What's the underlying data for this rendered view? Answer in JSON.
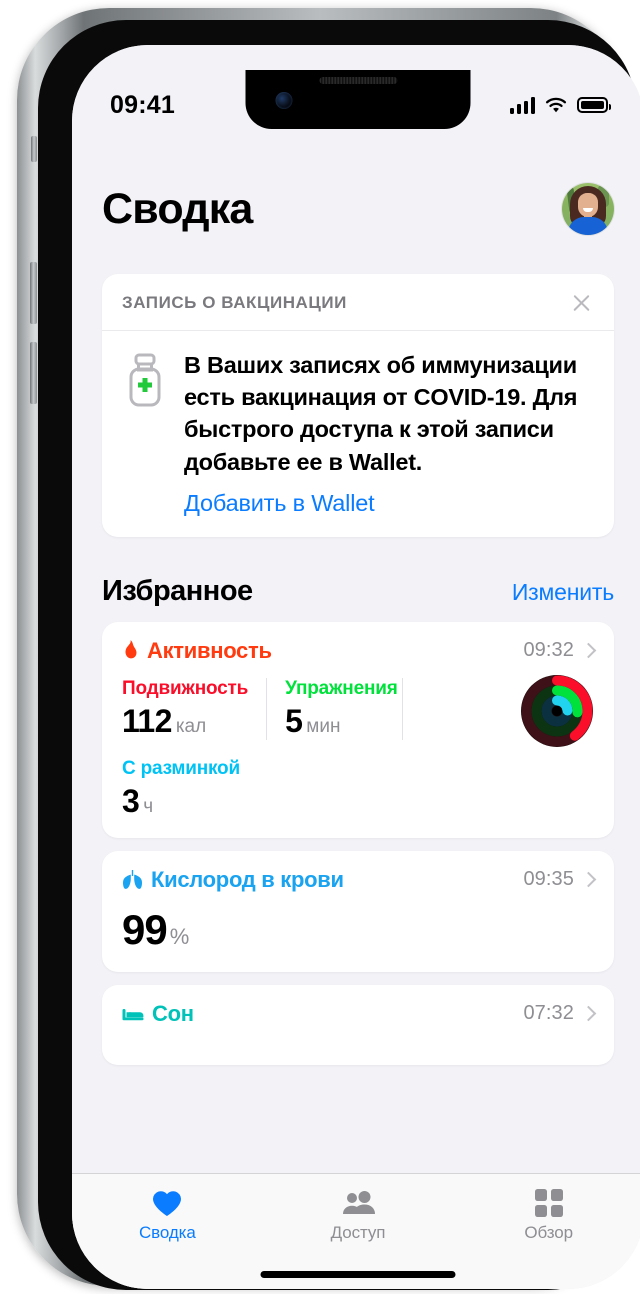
{
  "status_bar": {
    "time": "09:41",
    "icons": [
      "cellular-signal-icon",
      "wifi-icon",
      "battery-icon"
    ]
  },
  "header": {
    "title": "Сводка",
    "avatar_alt": "profile-avatar"
  },
  "vaccination_card": {
    "header_title": "ЗАПИСЬ О ВАКЦИНАЦИИ",
    "close_icon": "close-icon",
    "vial_icon": "vaccine-vial-icon",
    "message": "В Ваших записях об иммунизации есть вакцинация от COVID-19. Для быстрого доступа к этой записи добавьте ее в Wallet.",
    "action_label": "Добавить в Wallet"
  },
  "favorites": {
    "title": "Избранное",
    "edit_label": "Изменить",
    "cards": [
      {
        "name": "Активность",
        "icon": "flame-icon",
        "color": "#FF3B0F",
        "time": "09:32",
        "metrics": [
          {
            "label": "Подвижность",
            "value": "112",
            "unit": "кал",
            "color": "#FA0E2A"
          },
          {
            "label": "Упражнения",
            "value": "5",
            "unit": "мин",
            "color": "#00E23B"
          },
          {
            "label": "С разминкой",
            "value": "3",
            "unit": "ч",
            "color": "#00C3F5"
          }
        ],
        "rings": {
          "move_pct": 40,
          "exercise_pct": 26,
          "stand_pct": 24,
          "move_color": "#FA0E2A",
          "exercise_color": "#00E23B",
          "stand_color": "#22D3F0"
        }
      },
      {
        "name": "Кислород в крови",
        "icon": "lungs-icon",
        "color": "#1AA3F0",
        "time": "09:35",
        "value": "99",
        "unit": "%"
      },
      {
        "name": "Сон",
        "icon": "bed-icon",
        "color": "#00C2B8",
        "time": "07:32"
      }
    ]
  },
  "tab_bar": {
    "tabs": [
      {
        "label": "Сводка",
        "icon": "heart-icon",
        "active": true
      },
      {
        "label": "Доступ",
        "icon": "people-icon",
        "active": false
      },
      {
        "label": "Обзор",
        "icon": "grid-icon",
        "active": false
      }
    ],
    "active_color": "#0A7CFF",
    "inactive_color": "#8E8E93"
  }
}
